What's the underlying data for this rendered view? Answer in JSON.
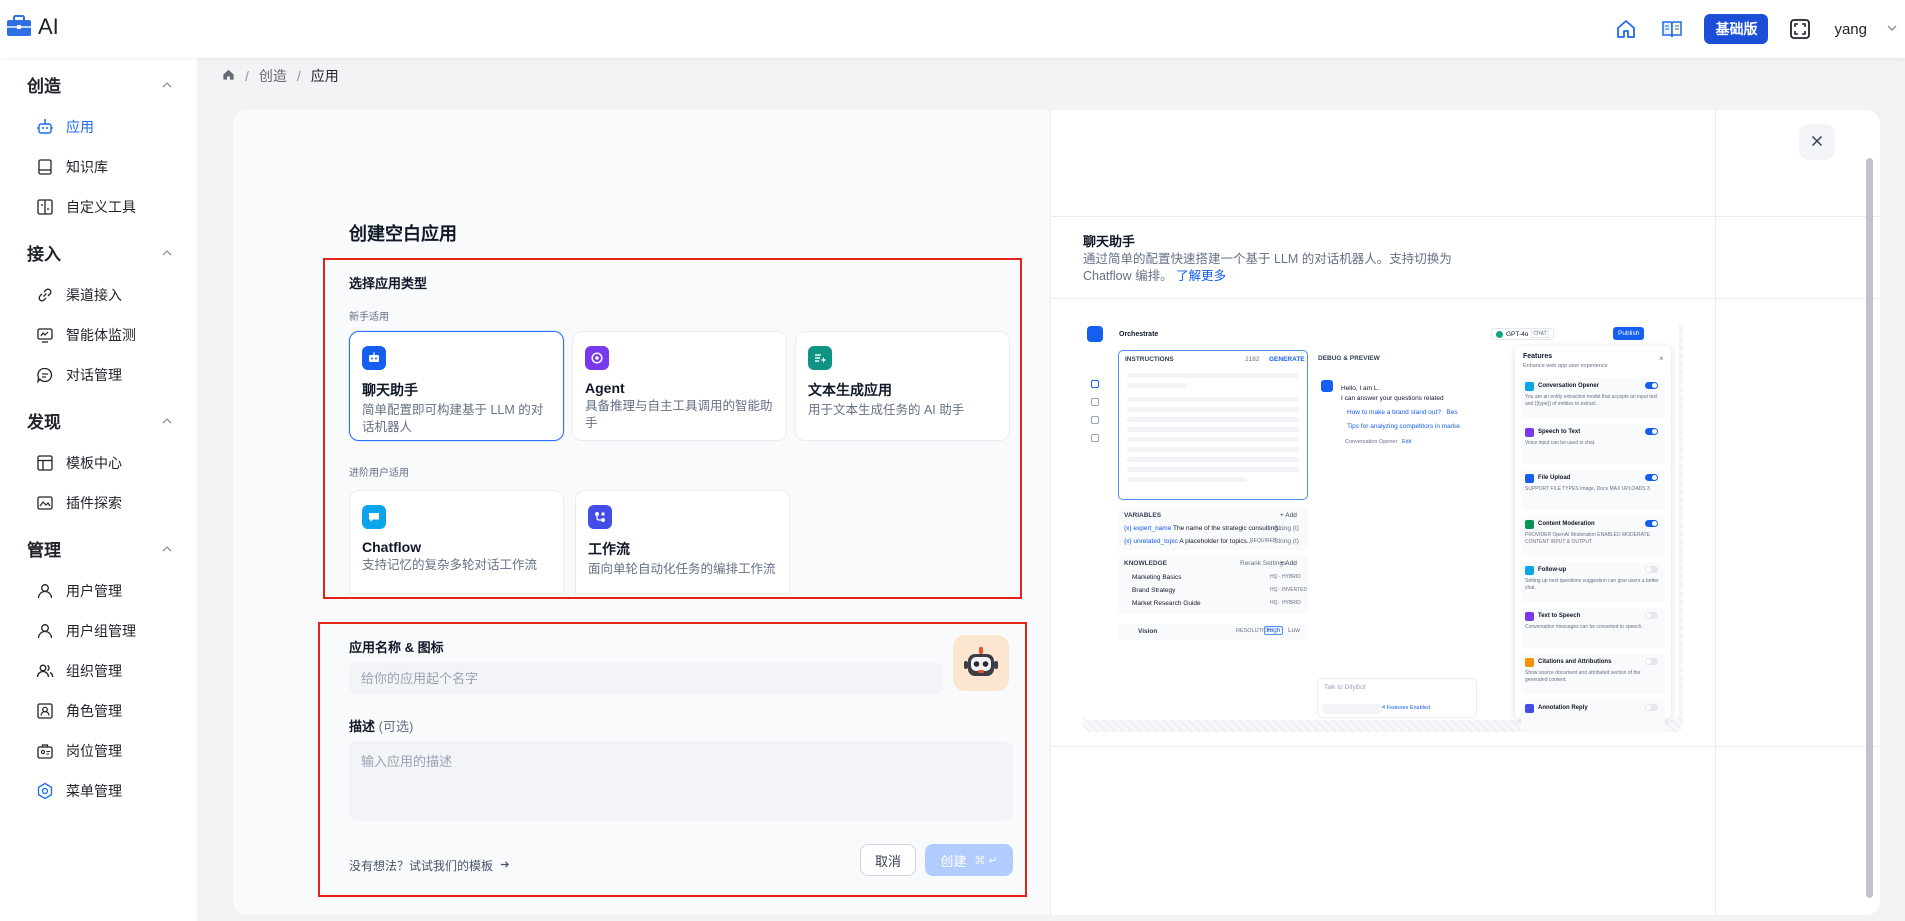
{
  "topbar": {
    "logo_text": "AI",
    "edition_label": "基础版",
    "user_name": "yang"
  },
  "sidebar": {
    "groups": [
      {
        "title": "创造",
        "items": [
          "应用",
          "知识库",
          "自定义工具"
        ]
      },
      {
        "title": "接入",
        "items": [
          "渠道接入",
          "智能体监测",
          "对话管理"
        ]
      },
      {
        "title": "发现",
        "items": [
          "模板中心",
          "插件探索"
        ]
      },
      {
        "title": "管理",
        "items": [
          "用户管理",
          "用户组管理",
          "组织管理",
          "角色管理",
          "岗位管理",
          "菜单管理"
        ]
      }
    ],
    "active_item": "应用"
  },
  "breadcrumb": {
    "items": [
      "创造",
      "应用"
    ]
  },
  "create": {
    "title": "创建空白应用",
    "type_section_title": "选择应用类型",
    "beginner_label": "新手适用",
    "advanced_label": "进阶用户适用",
    "types": [
      {
        "name": "聊天助手",
        "desc": "简单配置即可构建基于 LLM 的对话机器人",
        "color": "#155eef"
      },
      {
        "name": "Agent",
        "desc": "具备推理与自主工具调用的智能助手",
        "color": "#7839ee"
      },
      {
        "name": "文本生成应用",
        "desc": "用于文本生成任务的 AI 助手",
        "color": "#0e9384"
      },
      {
        "name": "Chatflow",
        "desc": "支持记忆的复杂多轮对话工作流",
        "color": "#0ba5ec"
      },
      {
        "name": "工作流",
        "desc": "面向单轮自动化任务的编排工作流",
        "color": "#444ce7"
      }
    ],
    "name_label": "应用名称 & 图标",
    "name_placeholder": "给你的应用起个名字",
    "desc_label": "描述",
    "desc_optional": "(可选)",
    "desc_placeholder": "输入应用的描述",
    "template_link": "没有想法？试试我们的模板",
    "cancel_label": "取消",
    "create_label": "创建",
    "create_shortcut": "⌘ ↵"
  },
  "preview": {
    "title": "聊天助手",
    "desc": "通过简单的配置快速搭建一个基于 LLM 的对话机器人。支持切换为 Chatflow 编排。",
    "learn_more": "了解更多",
    "shot": {
      "header": "Orchestrate",
      "model": "GPT-4o",
      "model_tag": "CHAT",
      "publish": "Publish",
      "instructions": "INSTRUCTIONS",
      "instructions_count": "2182",
      "generate": "GENERATE",
      "debug": "DEBUG & PREVIEW",
      "greeting": "Hello, I am L.",
      "greeting2": "I can answer your questions related",
      "suggest1": "How to make a brand stand out?",
      "suggest1_tail": "Bes",
      "suggest2": "Tips for analyzing competitors in marke",
      "opener_note": "Conversation Opener",
      "opener_edit": "Edit",
      "variables": "VARIABLES",
      "add": "+ Add",
      "var1": "{x} expert_name",
      "var1_desc": "The name of the strategic consulting...",
      "var1_type": "String (t)",
      "var2": "{x} unrelated_topic",
      "var2_desc": "A placeholder for topics...",
      "var2_req": "REQUIRED",
      "var2_type": "String (t)",
      "knowledge": "KNOWLEDGE",
      "rerank": "Rerank Settings",
      "kb": [
        {
          "name": "Marketing Basics",
          "tag": "HQ · HYBRID"
        },
        {
          "name": "Brand Strategy",
          "tag": "HQ · INVERTED"
        },
        {
          "name": "Market Research Guide",
          "tag": "HQ · HYBRID"
        }
      ],
      "vision": "Vision",
      "resolution": "RESOLUTION",
      "high": "High",
      "low": "Low",
      "talk": "Talk to DifyBot",
      "features_enabled": "4 Features Enabled",
      "features_title": "Features",
      "features_sub": "Enhance web app user experience",
      "features": [
        {
          "name": "Conversation Opener",
          "desc": "You are an entity extraction model that accepts an input text and {{type}} of entities to extract.",
          "on": true,
          "color": "#0ba5ec"
        },
        {
          "name": "Speech to Text",
          "desc": "Voice input can be used in chat.",
          "on": true,
          "color": "#7839ee"
        },
        {
          "name": "File Upload",
          "desc": "SUPPORT FILE TYPES  Image, Docs   MAX UPLOADS  3",
          "on": true,
          "color": "#155eef"
        },
        {
          "name": "Content Moderation",
          "desc": "PROVIDER  OpenAI Moderation   ENABLED MODERATE CONTENT  INPUT & OUTPUT",
          "on": true,
          "color": "#079455"
        },
        {
          "name": "Follow-up",
          "desc": "Setting up next questions suggestion can give users a better chat.",
          "on": false,
          "color": "#0ba5ec"
        },
        {
          "name": "Text to Speech",
          "desc": "Conversation messages can be converted to speech.",
          "on": false,
          "color": "#7839ee"
        },
        {
          "name": "Citations and Attributions",
          "desc": "Show source document and attributed section of the generated content.",
          "on": false,
          "color": "#f79009"
        },
        {
          "name": "Annotation Reply",
          "desc": "",
          "on": false,
          "color": "#444ce7"
        }
      ]
    }
  }
}
